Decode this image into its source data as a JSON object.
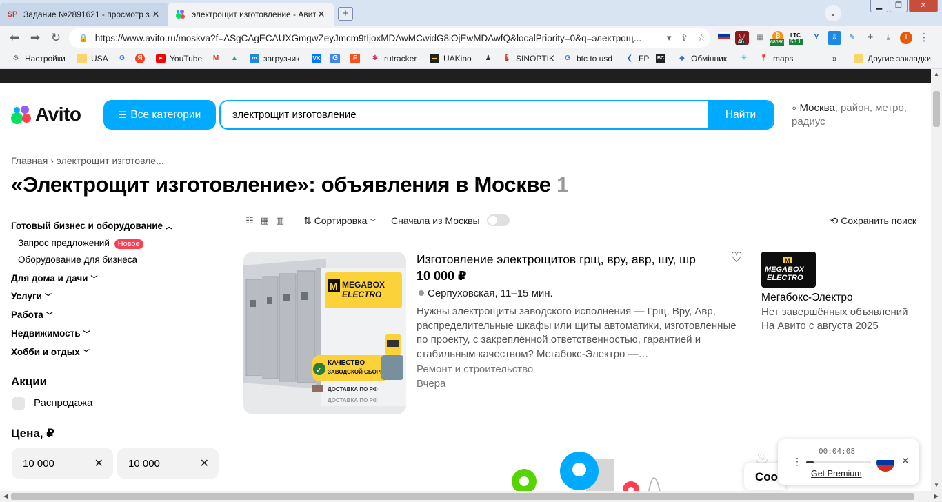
{
  "browser": {
    "tabs": [
      {
        "label": "Задание №2891621 - просмотр з",
        "favicon": "SP"
      },
      {
        "label": "электрощит изготовление - Авито",
        "favicon": "avito"
      }
    ],
    "url": "https://www.avito.ru/moskva?f=ASgCAgECAUXGmgwZeyJmcm9tIjoxMDAwMCwidG8iOjEwMDAwfQ&localPriority=0&q=электрощ...",
    "extensions": {
      "badge_46": "46",
      "btc_price": "68636",
      "ltc_label": "LTC",
      "ltc_price": "53.1",
      "profile_letter": "I"
    },
    "bookmarks": [
      {
        "label": "Настройки"
      },
      {
        "label": "USA"
      },
      {
        "label": ""
      },
      {
        "label": ""
      },
      {
        "label": "YouTube"
      },
      {
        "label": ""
      },
      {
        "label": ""
      },
      {
        "label": "загрузчик"
      },
      {
        "label": ""
      },
      {
        "label": ""
      },
      {
        "label": ""
      },
      {
        "label": "rutracker"
      },
      {
        "label": "UAKino"
      },
      {
        "label": ""
      },
      {
        "label": "SINOPTIK"
      },
      {
        "label": "btc to usd"
      },
      {
        "label": "FP"
      },
      {
        "label": ""
      },
      {
        "label": "Обмінник"
      },
      {
        "label": ""
      },
      {
        "label": "maps"
      }
    ],
    "bookmarks_overflow": "»",
    "other_bookmarks": "Другие закладки"
  },
  "header": {
    "logo": "Avito",
    "categories_button": "Все категории",
    "search_value": "электрощит изготовление",
    "search_button": "Найти",
    "location_city": "Москва",
    "location_rest": ", район, метро, радиус"
  },
  "breadcrumb": {
    "home": "Главная",
    "separator": "›",
    "current": "электрощит изготовле..."
  },
  "title": {
    "text": "«Электрощит изготовление»: объявления в Москве",
    "count": "1"
  },
  "sidebar": {
    "category_open": "Готовый бизнес и оборудование",
    "sub_items": [
      {
        "label": "Запрос предложений",
        "badge": "Новое"
      },
      {
        "label": "Оборудование для бизнеса"
      }
    ],
    "categories": [
      "Для дома и дачи",
      "Услуги",
      "Работа",
      "Недвижимость",
      "Хобби и отдых"
    ],
    "promo_heading": "Акции",
    "sale_checkbox": "Распродажа",
    "price_heading": "Цена, ₽",
    "price_from": "10 000",
    "price_to": "10 000"
  },
  "toolbar": {
    "sort": "Сортировка",
    "moscow_first": "Сначала из Москвы",
    "save_search": "Сохранить поиск"
  },
  "listing": {
    "title": "Изготовление электрощитов грщ, вру, авр, шу, шр",
    "price": "10 000 ₽",
    "metro": "Серпуховская, 11–15 мин.",
    "description": "Нужны электрощиты заводского исполнения — Грщ, Вру, Авр, распределительные шкафы или щиты автоматики, изготовленные по проекту, с закреплённой ответственностью, гарантией и стабильным качеством? Мегабокс-Электро —…",
    "category": "Ремонт и строительство",
    "date": "Вчера",
    "image_texts": {
      "brand_line1": "MEGABOX",
      "brand_line2": "ELECTRO",
      "quality": "КАЧЕСТВО",
      "assembly": "ЗАВОДСКОЙ СБОРКИ",
      "delivery": "ДОСТАВКА ПО РФ"
    }
  },
  "seller": {
    "logo_line1": "MEGABOX",
    "logo_line2": "ELECTRO",
    "name": "Мегабокс-Электро",
    "deals": "Нет завершённых объявлений",
    "since": "На Авито с августа 2025"
  },
  "cookie_banner": {
    "text": "Coo"
  },
  "recorder": {
    "time": "00:04:08",
    "progress": 0.12,
    "premium": "Get Premium"
  },
  "colors": {
    "accent": "#00aaff",
    "new_badge": "#ff4053"
  }
}
